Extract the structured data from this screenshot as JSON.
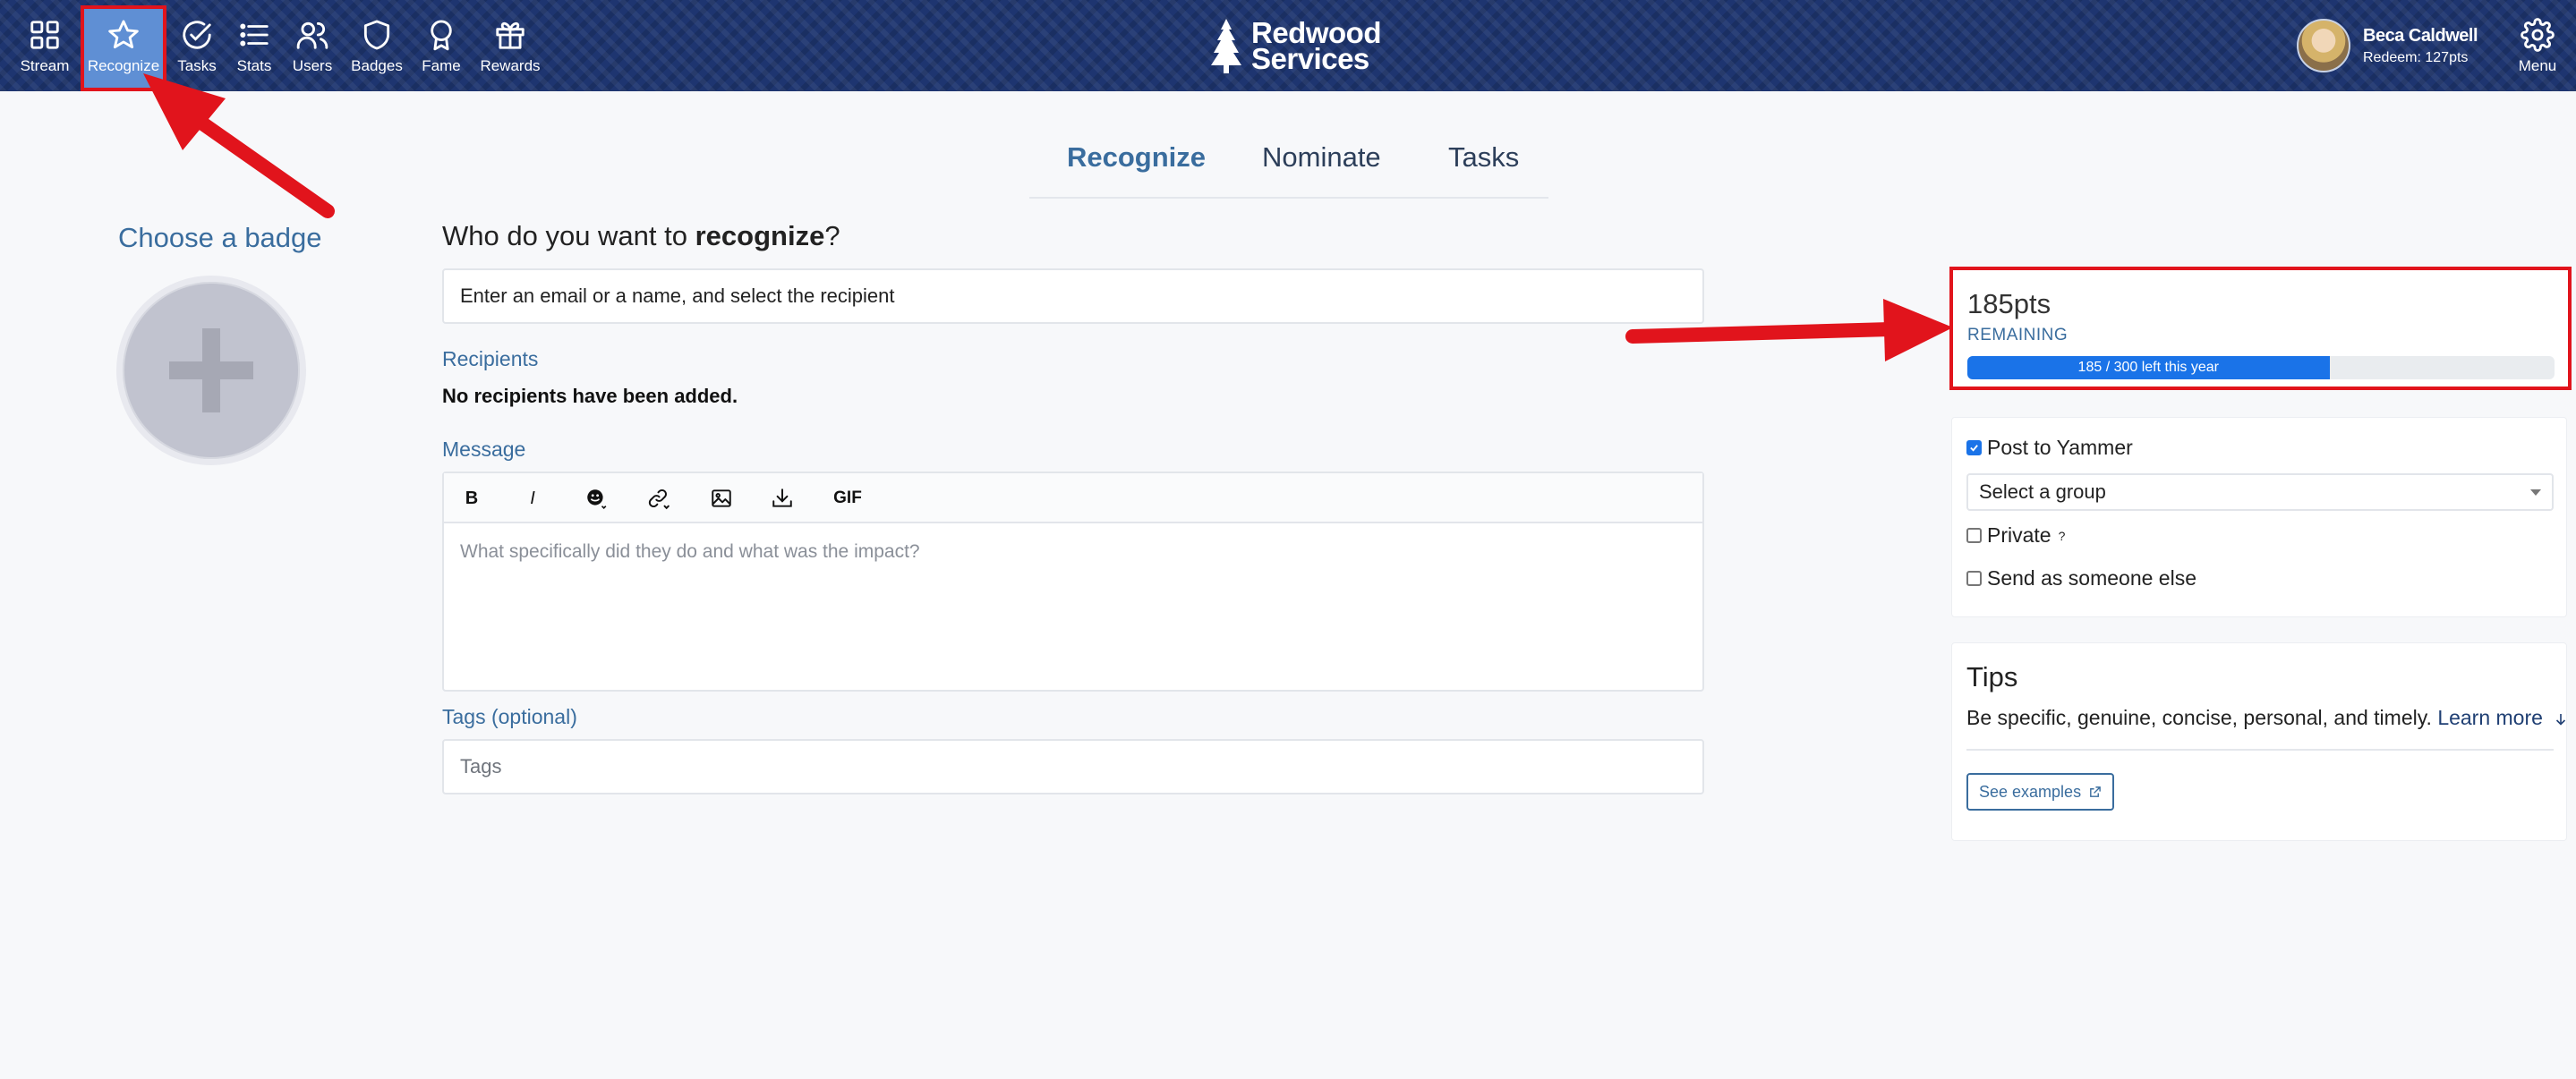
{
  "nav": {
    "items": [
      {
        "label": "Stream",
        "icon": "grid-icon"
      },
      {
        "label": "Recognize",
        "icon": "star-icon",
        "active": true
      },
      {
        "label": "Tasks",
        "icon": "check-circle-icon"
      },
      {
        "label": "Stats",
        "icon": "list-icon"
      },
      {
        "label": "Users",
        "icon": "users-icon"
      },
      {
        "label": "Badges",
        "icon": "shield-icon"
      },
      {
        "label": "Fame",
        "icon": "award-icon"
      },
      {
        "label": "Rewards",
        "icon": "gift-icon"
      }
    ],
    "logo_line1": "Redwood",
    "logo_line2": "Services",
    "user_name": "Beca Caldwell",
    "user_redeem": "Redeem: 127pts",
    "menu_label": "Menu"
  },
  "tabs": [
    {
      "label": "Recognize",
      "active": true
    },
    {
      "label": "Nominate"
    },
    {
      "label": "Tasks"
    }
  ],
  "badge": {
    "title": "Choose a badge"
  },
  "form": {
    "heading_prefix": "Who do you want to ",
    "heading_bold": "recognize",
    "heading_suffix": "?",
    "recipient_value": "Enter an email or a name, and select the recipient",
    "recipients_label": "Recipients",
    "no_recipients": "No recipients have been added.",
    "message_label": "Message",
    "message_placeholder": "What specifically did they do and what was the impact?",
    "toolbar": {
      "bold": "B",
      "italic": "I",
      "gif": "GIF"
    },
    "tags_label": "Tags (optional)",
    "tags_placeholder": "Tags"
  },
  "points": {
    "value": "185pts",
    "remaining_label": "REMAINING",
    "progress_text": "185 / 300 left this year",
    "progress_fraction": 0.6167,
    "accent": "#1a73e8"
  },
  "post": {
    "post_to_yammer": "Post to Yammer",
    "post_to_yammer_checked": true,
    "group_select": "Select a group",
    "private_label": "Private",
    "private_help": "?",
    "send_as_label": "Send as someone else"
  },
  "tips": {
    "title": "Tips",
    "text": "Be specific, genuine, concise, personal, and timely.",
    "learn_more": "Learn more",
    "see_examples": "See examples"
  },
  "colors": {
    "nav_bg": "#1e3570",
    "accent_blue": "#3a6d9e",
    "annotation_red": "#e1141c"
  }
}
